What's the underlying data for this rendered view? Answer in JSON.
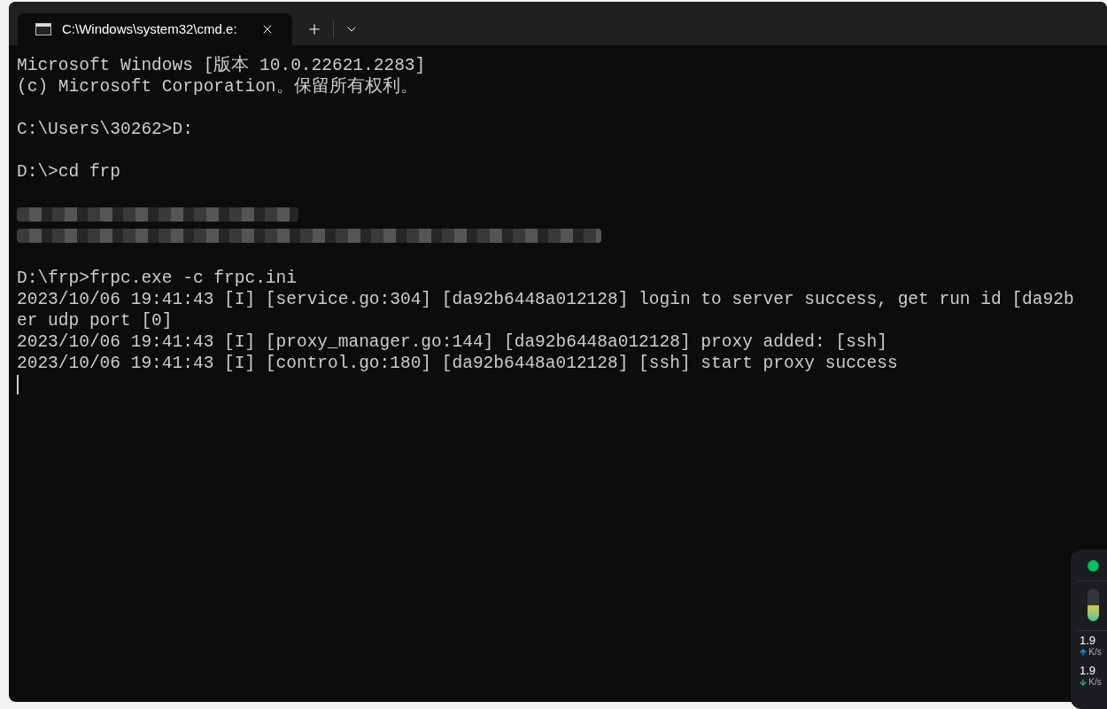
{
  "tab": {
    "title": "C:\\Windows\\system32\\cmd.e:",
    "selected": true
  },
  "terminal": {
    "lines": [
      {
        "kind": "text",
        "text": "Microsoft Windows [版本 10.0.22621.2283]"
      },
      {
        "kind": "text",
        "text": "(c) Microsoft Corporation。保留所有权利。"
      },
      {
        "kind": "blank"
      },
      {
        "kind": "text",
        "text": "C:\\Users\\30262>D:"
      },
      {
        "kind": "blank"
      },
      {
        "kind": "text",
        "text": "D:\\>cd frp"
      },
      {
        "kind": "blank"
      },
      {
        "kind": "redacted"
      },
      {
        "kind": "redacted"
      },
      {
        "kind": "blank"
      },
      {
        "kind": "text",
        "text": "D:\\frp>frpc.exe -c frpc.ini"
      },
      {
        "kind": "text",
        "text": "2023/10/06 19:41:43 [I] [service.go:304] [da92b6448a012128] login to server success, get run id [da92b"
      },
      {
        "kind": "text",
        "text": "er udp port [0]"
      },
      {
        "kind": "text",
        "text": "2023/10/06 19:41:43 [I] [proxy_manager.go:144] [da92b6448a012128] proxy added: [ssh]"
      },
      {
        "kind": "text",
        "text": "2023/10/06 19:41:43 [I] [control.go:180] [da92b6448a012128] [ssh] start proxy success"
      },
      {
        "kind": "cursor"
      }
    ]
  },
  "monitor": {
    "connected": true,
    "level": 0.5,
    "upload": "1.9",
    "upload_unit": "K/s",
    "download": "1.9",
    "download_unit": "K/s"
  }
}
